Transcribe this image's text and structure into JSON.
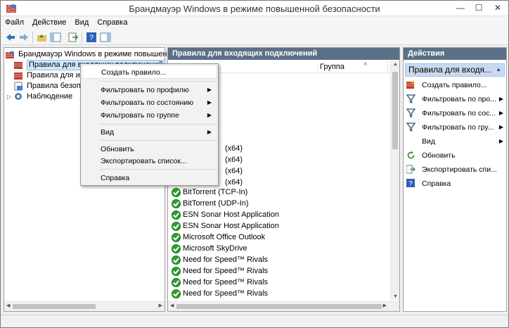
{
  "window": {
    "title": "Брандмауэр Windows в режиме повышенной безопасности",
    "minimize": "—",
    "maximize": "☐",
    "close": "✕"
  },
  "menu": [
    "Файл",
    "Действие",
    "Вид",
    "Справка"
  ],
  "tree": {
    "root": "Брандмауэр Windows в режиме повышенной",
    "items": [
      {
        "label": "Правила для входящих подключений"
      },
      {
        "label": "Правила для исходящих"
      },
      {
        "label": "Правила безопасности"
      },
      {
        "label": "Наблюдение"
      }
    ]
  },
  "middle": {
    "header": "Правила для входящих подключений",
    "col_group": "Группа",
    "rules_partial": [
      "(x64)",
      "(x64)",
      "(x64)",
      "(x64)"
    ],
    "rules": [
      "BitTorrent (TCP-In)",
      "BitTorrent (UDP-In)",
      "ESN Sonar Host Application",
      "ESN Sonar Host Application",
      "Microsoft Office Outlook",
      "Microsoft SkyDrive",
      "Need for Speed™ Rivals",
      "Need for Speed™ Rivals",
      "Need for Speed™ Rivals",
      "Need for Speed™ Rivals"
    ]
  },
  "actions": {
    "header": "Действия",
    "subheader": "Правила для входя...",
    "items": [
      {
        "label": "Создать правило...",
        "icon": "new-rule-icon",
        "submenu": false
      },
      {
        "label": "Фильтровать по про...",
        "icon": "filter-icon",
        "submenu": true
      },
      {
        "label": "Фильтровать по сос...",
        "icon": "filter-icon",
        "submenu": true
      },
      {
        "label": "Фильтровать по гру...",
        "icon": "filter-icon",
        "submenu": true
      },
      {
        "label": "Вид",
        "icon": "",
        "submenu": true
      },
      {
        "label": "Обновить",
        "icon": "refresh-icon",
        "submenu": false
      },
      {
        "label": "Экспортировать спи...",
        "icon": "export-icon",
        "submenu": false
      },
      {
        "label": "Справка",
        "icon": "help-icon",
        "submenu": false
      }
    ]
  },
  "context_menu": {
    "items": [
      {
        "label": "Создать правило...",
        "submenu": false
      },
      {
        "label": "Фильтровать по профилю",
        "submenu": true
      },
      {
        "label": "Фильтровать по состоянию",
        "submenu": true
      },
      {
        "label": "Фильтровать по группе",
        "submenu": true
      },
      {
        "label": "Вид",
        "submenu": true
      },
      {
        "label": "Обновить",
        "submenu": false
      },
      {
        "label": "Экспортировать список...",
        "submenu": false
      },
      {
        "label": "Справка",
        "submenu": false
      }
    ]
  },
  "colors": {
    "pane_header": "#5a7086",
    "selection": "#c9daf0",
    "rule_enabled": "#2e9c2e"
  }
}
